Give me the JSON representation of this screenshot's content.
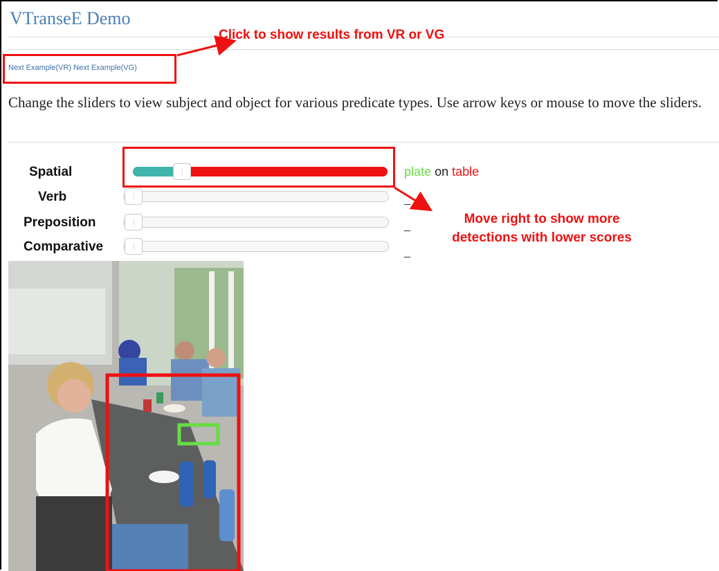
{
  "page": {
    "title": "VTranseE Demo"
  },
  "links": {
    "vr": "Next Example(VR)",
    "vg": "Next Example(VG)"
  },
  "description": "Change the sliders to view subject and object for various predicate types. Use arrow keys or mouse to move the sliders.",
  "sliders": [
    {
      "label": "Spatial",
      "value": 0.17,
      "subject": "plate",
      "relation": "on",
      "object": "table"
    },
    {
      "label": "Verb",
      "value": 0,
      "result": "_"
    },
    {
      "label": "Preposition",
      "value": 0,
      "result": "_"
    },
    {
      "label": "Comparative",
      "value": 0,
      "result": "_"
    }
  ],
  "annotations": {
    "top": "Click to show results from VR or VG",
    "side_line1": "Move right to show more",
    "side_line2": "detections with lower scores"
  },
  "colors": {
    "subject": "#66dd44",
    "object": "#ee1111",
    "slider_fill": "#3fb5ad",
    "annotation": "#ee1111",
    "title": "#4a7fb5"
  }
}
